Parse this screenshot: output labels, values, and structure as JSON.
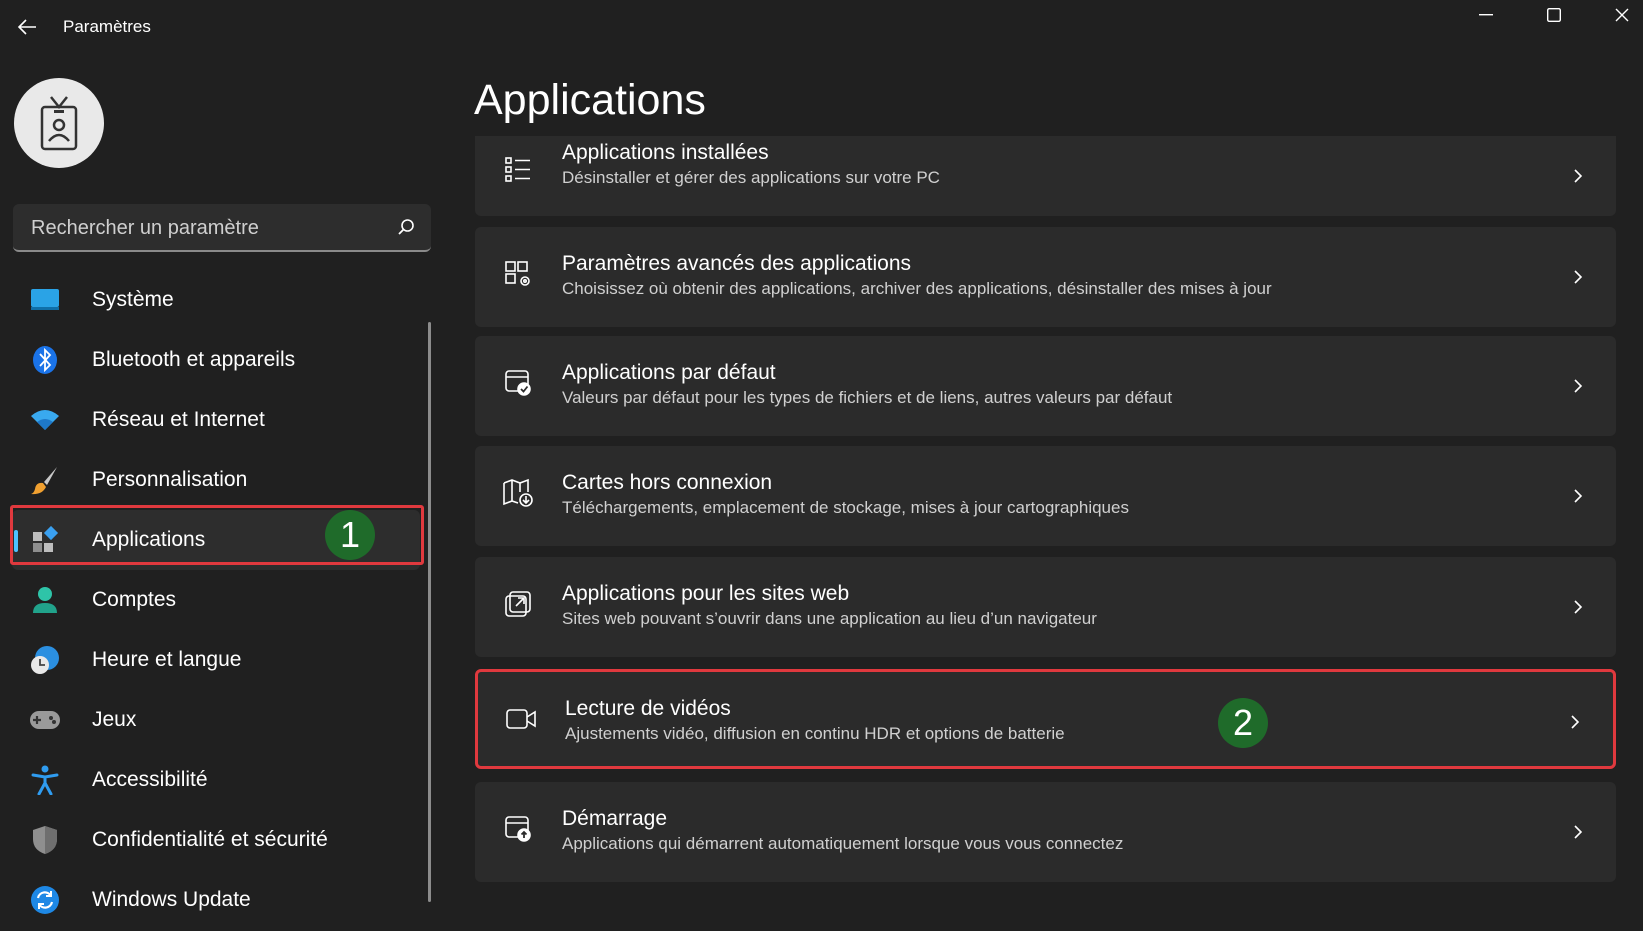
{
  "window": {
    "title": "Paramètres"
  },
  "search": {
    "placeholder": "Rechercher un paramètre"
  },
  "sidebar": {
    "items": [
      {
        "label": "Système",
        "icon": "system-icon"
      },
      {
        "label": "Bluetooth et appareils",
        "icon": "bluetooth-icon"
      },
      {
        "label": "Réseau et Internet",
        "icon": "wifi-icon"
      },
      {
        "label": "Personnalisation",
        "icon": "paintbrush-icon"
      },
      {
        "label": "Applications",
        "icon": "apps-icon",
        "active": true
      },
      {
        "label": "Comptes",
        "icon": "account-icon"
      },
      {
        "label": "Heure et langue",
        "icon": "clock-globe-icon"
      },
      {
        "label": "Jeux",
        "icon": "gamepad-icon"
      },
      {
        "label": "Accessibilité",
        "icon": "accessibility-icon"
      },
      {
        "label": "Confidentialité et sécurité",
        "icon": "shield-icon"
      },
      {
        "label": "Windows Update",
        "icon": "update-icon"
      }
    ]
  },
  "main": {
    "title": "Applications",
    "cards": [
      {
        "title": "Applications installées",
        "subtitle": "Désinstaller et gérer des applications sur votre PC",
        "icon": "list-icon"
      },
      {
        "title": "Paramètres avancés des applications",
        "subtitle": "Choisissez où obtenir des applications, archiver des applications, désinstaller des mises à jour",
        "icon": "apps-gear-icon"
      },
      {
        "title": "Applications par défaut",
        "subtitle": "Valeurs par défaut pour les types de fichiers et de liens, autres valeurs par défaut",
        "icon": "default-apps-icon"
      },
      {
        "title": "Cartes hors connexion",
        "subtitle": "Téléchargements, emplacement de stockage, mises à jour cartographiques",
        "icon": "map-download-icon"
      },
      {
        "title": "Applications pour les sites web",
        "subtitle": "Sites web pouvant s’ouvrir dans une application au lieu d’un navigateur",
        "icon": "open-external-icon"
      },
      {
        "title": "Lecture de vidéos",
        "subtitle": "Ajustements vidéo, diffusion en continu HDR et options de batterie",
        "icon": "video-camera-icon"
      },
      {
        "title": "Démarrage",
        "subtitle": "Applications qui démarrent automatiquement lorsque vous vous connectez",
        "icon": "startup-icon"
      }
    ]
  },
  "annotations": {
    "badge1": "1",
    "badge2": "2"
  },
  "colors": {
    "accent": "#4cc2ff",
    "highlight": "#e0393e",
    "badge": "#1f6b2a"
  }
}
